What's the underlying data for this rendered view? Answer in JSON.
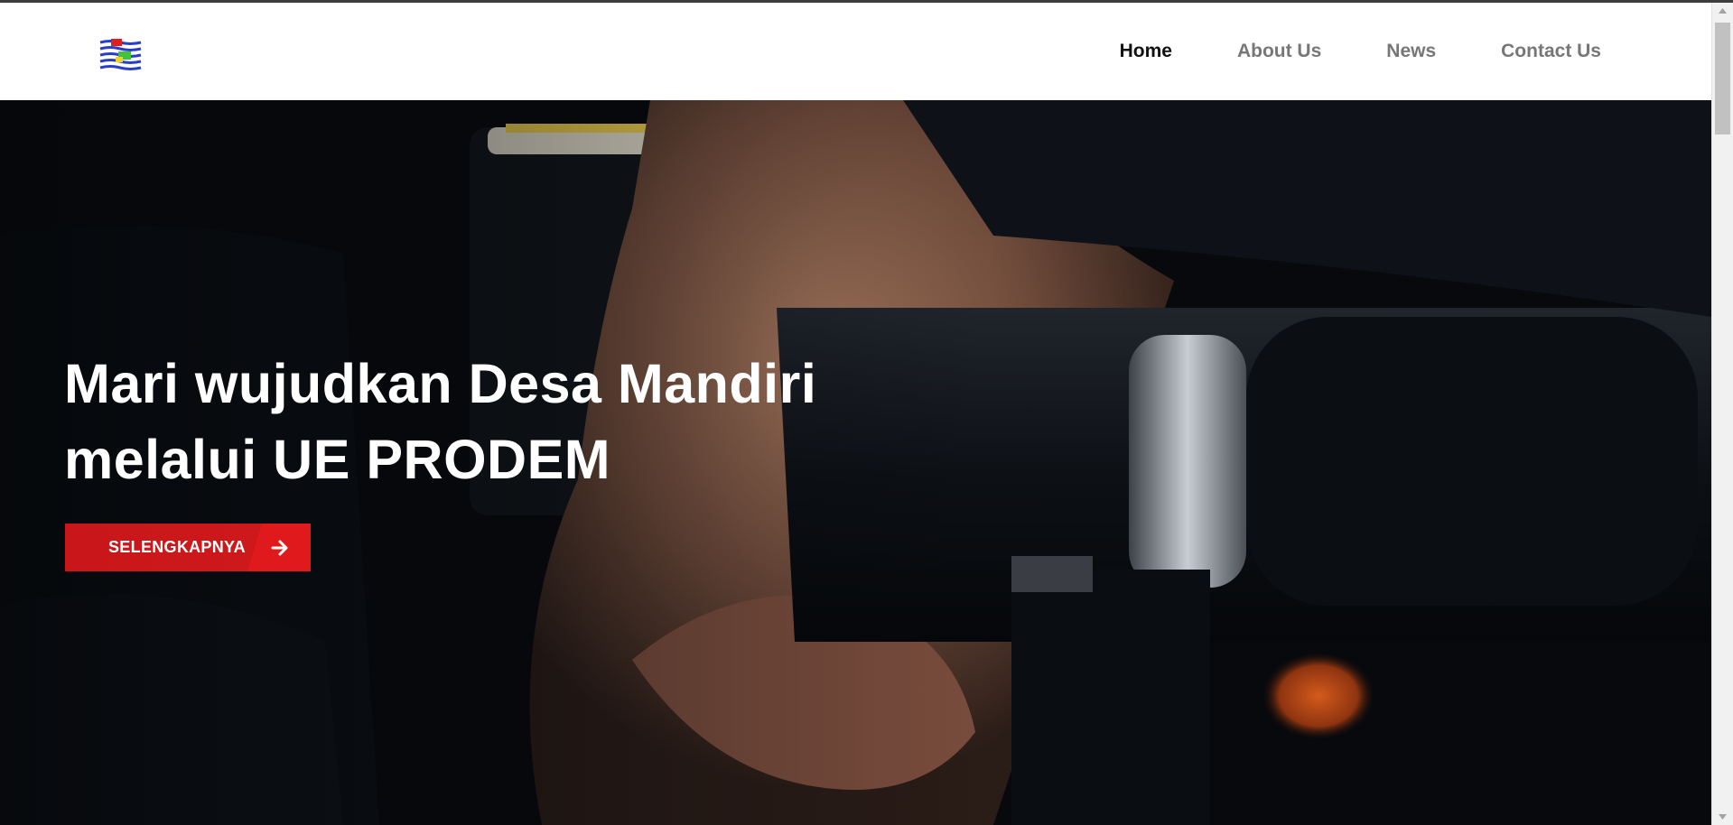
{
  "header": {
    "logo_icon": "prodem-logo-icon"
  },
  "nav": {
    "items": [
      {
        "label": "Home",
        "active": true
      },
      {
        "label": "About Us",
        "active": false
      },
      {
        "label": "News",
        "active": false
      },
      {
        "label": "Contact Us",
        "active": false
      }
    ]
  },
  "hero": {
    "title_line1": "Mari wujudkan Desa Mandiri",
    "title_line2": "melalui UE PRODEM",
    "button_label": "SELENGKAPNYA",
    "button_icon": "arrow-right-icon"
  },
  "colors": {
    "accent": "#d0191c",
    "nav_active": "#111111",
    "nav_inactive": "#777777",
    "hero_background": "#07090d"
  }
}
